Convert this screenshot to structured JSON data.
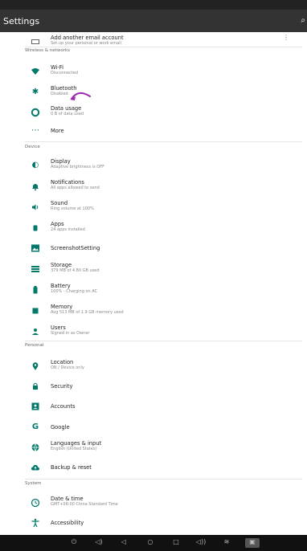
{
  "app": {
    "title": "Settings"
  },
  "top": {
    "add_account_title": "Add another email account",
    "add_account_sub": "Set up your personal or work email"
  },
  "sections": {
    "wireless": "Wireless & networks",
    "device": "Device",
    "personal": "Personal",
    "system": "System"
  },
  "items": {
    "wifi": {
      "title": "Wi-Fi",
      "sub": "Disconnected"
    },
    "bluetooth": {
      "title": "Bluetooth",
      "sub": "Disabled"
    },
    "data": {
      "title": "Data usage",
      "sub": "0 B of data used"
    },
    "more": {
      "title": "More"
    },
    "display": {
      "title": "Display",
      "sub": "Adaptive brightness is OFF"
    },
    "notifications": {
      "title": "Notifications",
      "sub": "All apps allowed to send"
    },
    "sound": {
      "title": "Sound",
      "sub": "Ring volume at 100%"
    },
    "apps": {
      "title": "Apps",
      "sub": "24 apps installed"
    },
    "screenshot": {
      "title": "ScreenshotSetting"
    },
    "storage": {
      "title": "Storage",
      "sub": "379 MB of 4.80 GB used"
    },
    "battery": {
      "title": "Battery",
      "sub": "100% - Charging on AC"
    },
    "memory": {
      "title": "Memory",
      "sub": "Avg 513 MB of 1.9 GB memory used"
    },
    "users": {
      "title": "Users",
      "sub": "Signed in as Owner"
    },
    "location": {
      "title": "Location",
      "sub": "ON / Device only"
    },
    "security": {
      "title": "Security"
    },
    "accounts": {
      "title": "Accounts"
    },
    "google": {
      "title": "Google"
    },
    "languages": {
      "title": "Languages & input",
      "sub": "English (United States)"
    },
    "backup": {
      "title": "Backup & reset"
    },
    "datetime": {
      "title": "Date & time",
      "sub": "GMT+08:00 China Standard Time"
    },
    "accessibility": {
      "title": "Accessibility"
    }
  },
  "colors": {
    "accent": "#00796b",
    "annotation": "#9c27b0"
  }
}
